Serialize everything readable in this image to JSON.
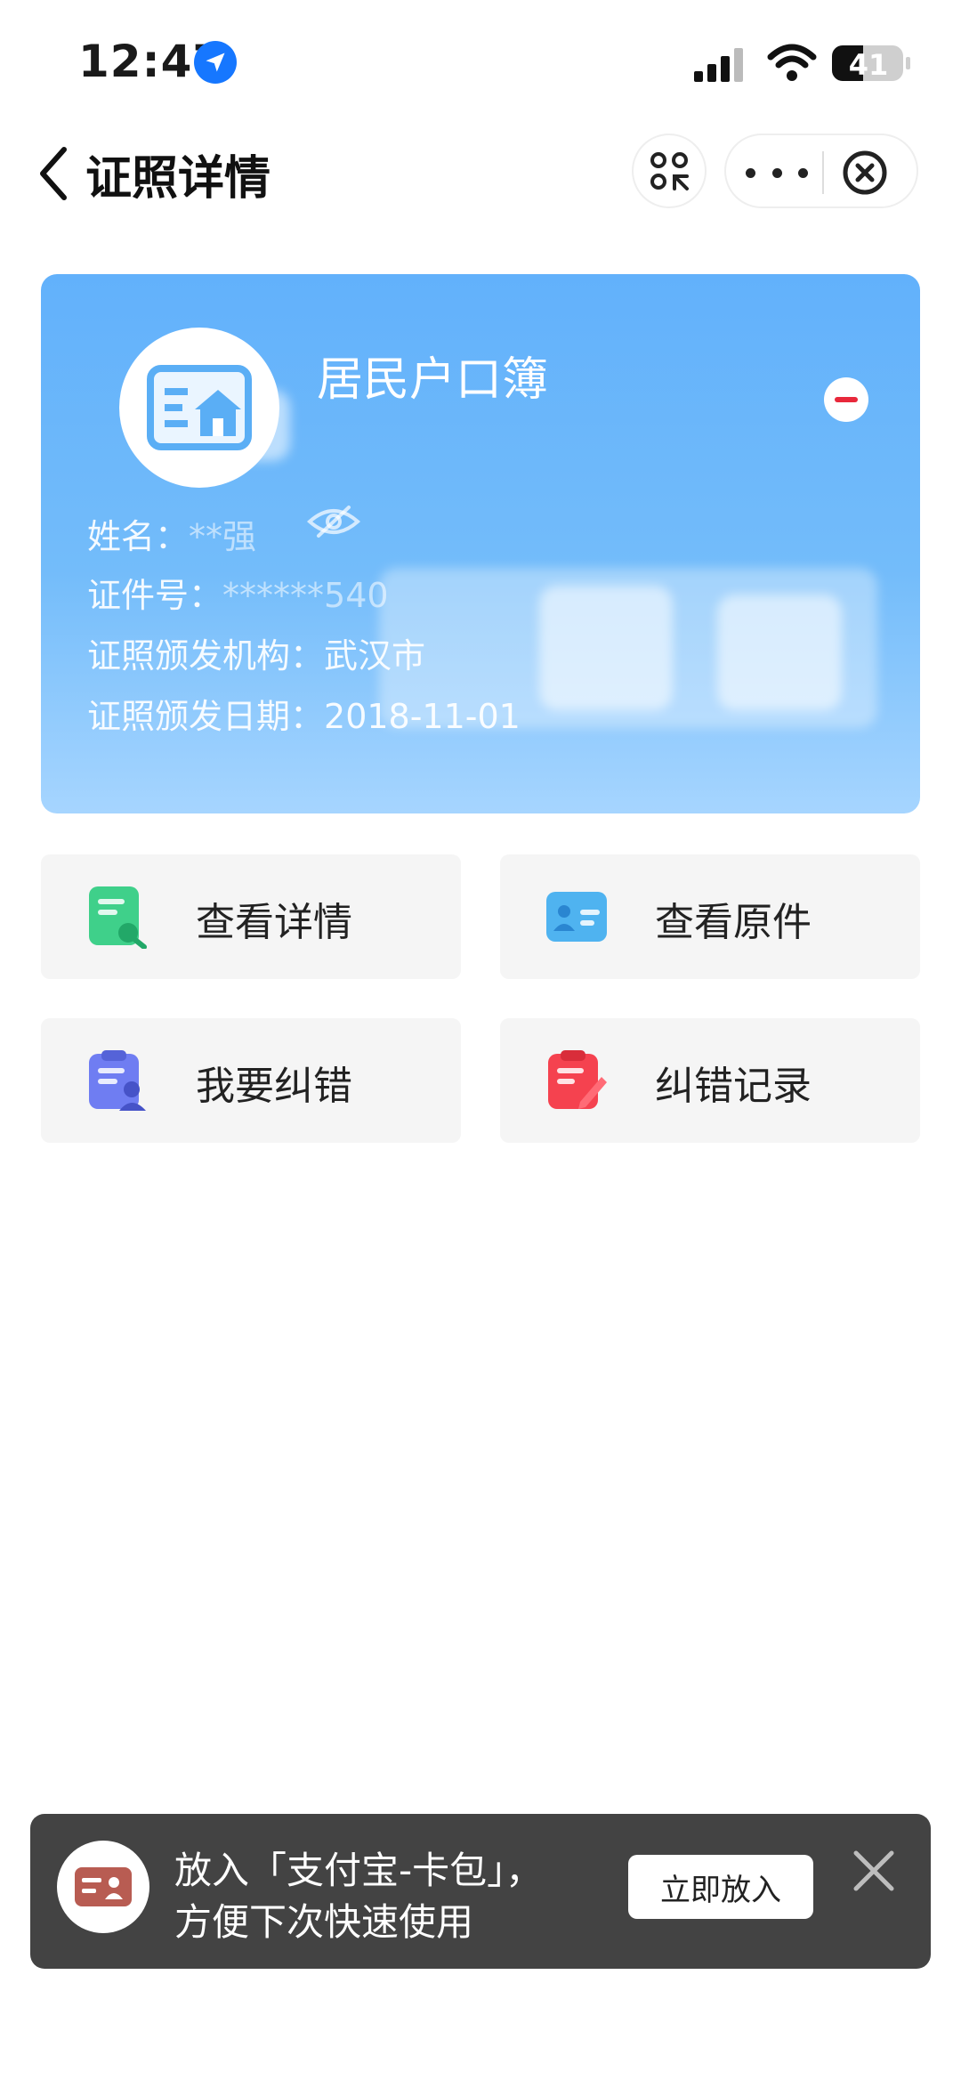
{
  "status_bar": {
    "time": "12:47",
    "battery": "41"
  },
  "nav": {
    "title": "证照详情"
  },
  "card": {
    "title": "居民户口簿",
    "fields": [
      {
        "label": "姓名：",
        "value": "**强"
      },
      {
        "label": "证件号：",
        "value": "******540"
      },
      {
        "label": "证照颁发机构：",
        "value": "武汉市"
      },
      {
        "label": "证照颁发日期：",
        "value": "2018-11-01"
      }
    ],
    "bg_color": "#62b1fb"
  },
  "actions": [
    {
      "label": "查看详情",
      "icon": "document-search-icon",
      "color": "#3fd08a"
    },
    {
      "label": "查看原件",
      "icon": "id-card-icon",
      "color": "#4fb3f0"
    },
    {
      "label": "我要纠错",
      "icon": "clipboard-user-icon",
      "color": "#6f7df2"
    },
    {
      "label": "纠错记录",
      "icon": "clipboard-edit-icon",
      "color": "#f5424f"
    }
  ],
  "banner": {
    "line1": "放入「支付宝-卡包」，",
    "line2": "方便下次快速使用",
    "button": "立即放入"
  },
  "colors": {
    "accent": "#1677ff",
    "danger": "#e8283b",
    "banner_bg": "#434343"
  }
}
